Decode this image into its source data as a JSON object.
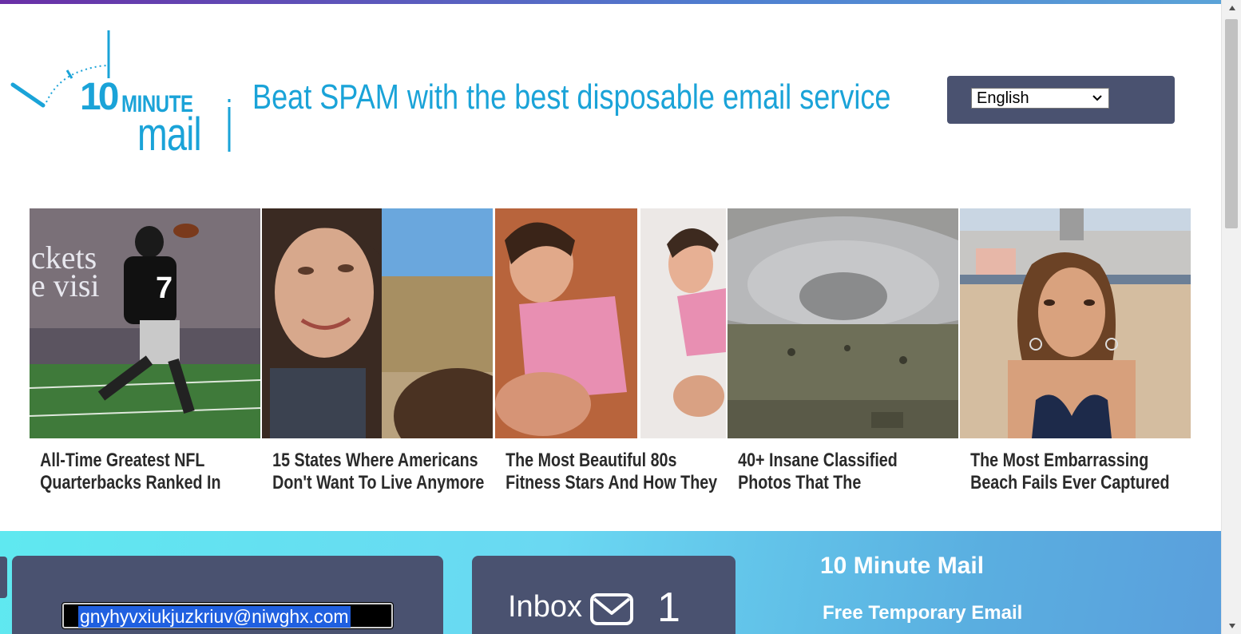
{
  "header": {
    "logo": {
      "number": "10",
      "word1": "MINUTE",
      "word2": "mail"
    },
    "tagline": "Beat SPAM with the best disposable email service",
    "language": {
      "selected": "English"
    }
  },
  "ads": [
    {
      "caption_line1": "All-Time Greatest NFL",
      "caption_line2": "Quarterbacks Ranked In"
    },
    {
      "caption_line1": "15 States Where Americans",
      "caption_line2": "Don't Want To Live Anymore"
    },
    {
      "caption_line1": "The Most Beautiful 80s",
      "caption_line2": "Fitness Stars And How They"
    },
    {
      "caption_line1": "40+ Insane Classified",
      "caption_line2": "Photos That The"
    },
    {
      "caption_line1": "The Most Embarrassing",
      "caption_line2": "Beach Fails Ever Captured"
    }
  ],
  "mailbox": {
    "email": "gnyhyvxiukjuzkriuv@niwghx.com",
    "inbox_label": "Inbox",
    "inbox_count": "1"
  },
  "brand": {
    "title": "10 Minute Mail",
    "subtitle": "Free Temporary Email"
  },
  "colors": {
    "brand_blue": "#1aa3d8",
    "panel": "#4a5270",
    "band_start": "#5fe8f0",
    "band_end": "#5a9fdc"
  },
  "icons": [
    "clock-logo-icon",
    "chevron-down-icon",
    "envelope-icon",
    "scroll-up-icon",
    "scroll-down-icon"
  ]
}
